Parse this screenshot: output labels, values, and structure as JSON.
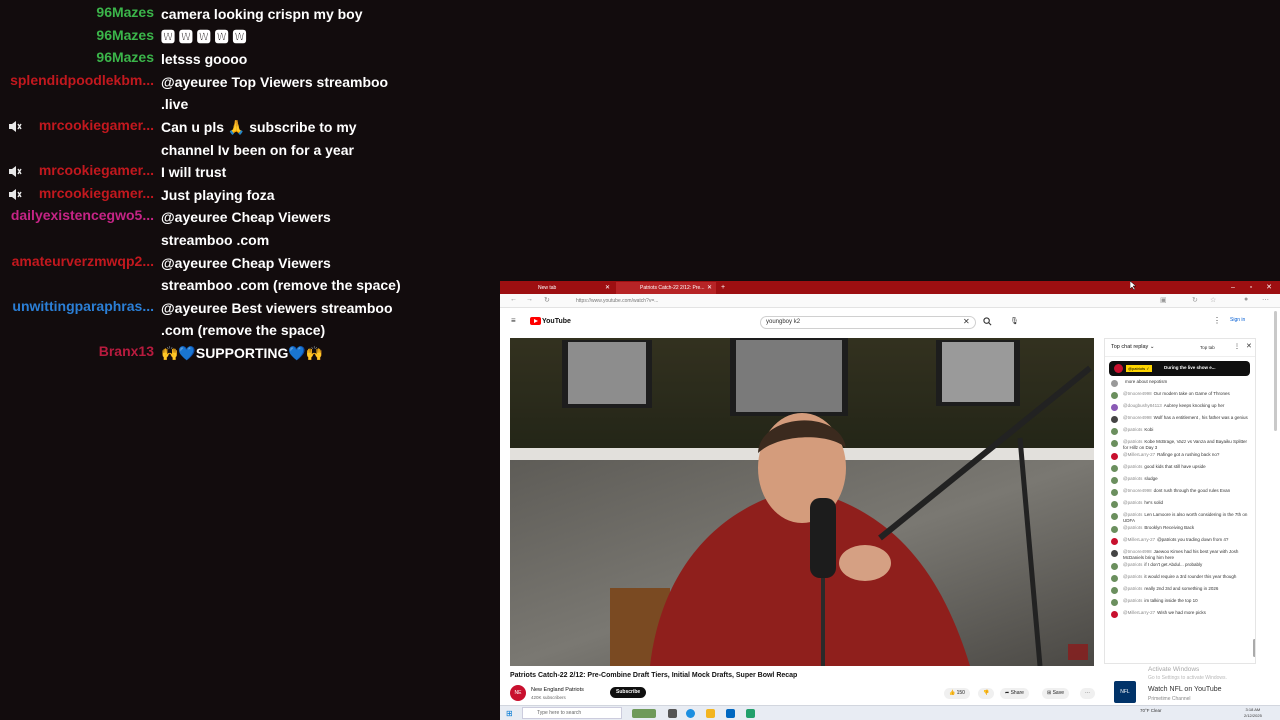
{
  "colors": {
    "background": "#120c0d",
    "name_green": "#3bb54a",
    "name_red": "#c2181e",
    "name_magenta": "#c52486",
    "name_blue": "#2b7fd6",
    "name_dark_red": "#b81b3e",
    "browser_tabstrip": "#9d0f11",
    "youtube_red": "#ff0000"
  },
  "chat": [
    {
      "name": "96Mazes",
      "color": "#3bb54a",
      "message": "camera looking crispn my boy",
      "muted": false
    },
    {
      "name": "96Mazes",
      "color": "#3bb54a",
      "message": "🆆 🆆 🆆 🆆 🆆",
      "muted": false
    },
    {
      "name": "96Mazes",
      "color": "#3bb54a",
      "message": "letsss goooo",
      "muted": false
    },
    {
      "name": "splendidpoodlekbm...",
      "color": "#c2181e",
      "message": "@ayeuree Top Viewers streamboo .live",
      "muted": false
    },
    {
      "name": "mrcookiegamer...",
      "color": "#c2181e",
      "message": "Can u pls 🙏 subscribe to my channel Iv been on for a year",
      "muted": true
    },
    {
      "name": "mrcookiegamer...",
      "color": "#c2181e",
      "message": "I will trust",
      "muted": true
    },
    {
      "name": "mrcookiegamer...",
      "color": "#c2181e",
      "message": "Just playing foza",
      "muted": true
    },
    {
      "name": "dailyexistencegwo5...",
      "color": "#c52486",
      "message": "@ayeuree Cheap Viewers streamboo .com",
      "muted": false
    },
    {
      "name": "amateurverzmwqp2...",
      "color": "#c2181e",
      "message": "@ayeuree Cheap Viewers streamboo .com (remove the space)",
      "muted": false
    },
    {
      "name": "unwittingparaphras...",
      "color": "#2b7fd6",
      "message": "@ayeuree Best viewers streamboo .com (remove the space)",
      "muted": false
    },
    {
      "name": "Branx13",
      "color": "#b81b3e",
      "message": "🙌💙SUPPORTING💙🙌",
      "muted": false
    }
  ],
  "browser": {
    "tabs": [
      {
        "label": "New tab",
        "active": false
      },
      {
        "label": "Patriots Catch-22 2/12: Pre...",
        "active": true
      }
    ],
    "new_tab_icon": "plus-icon",
    "url": "https://www.youtube.com/watch?v=...",
    "window_controls": [
      "–",
      "▫",
      "✕"
    ]
  },
  "youtube": {
    "logo_text": "YouTube",
    "search_value": "youngboy k2",
    "sign_in": "Sign in",
    "video_title": "Patriots Catch-22 2/12: Pre-Combine Draft Tiers, Initial Mock Drafts, Super Bowl Recap",
    "channel_name": "New England Patriots",
    "channel_avatar_text": "NE",
    "channel_subs": "420K subscribers",
    "subscribe_label": "Subscribe",
    "like_count": "150",
    "share_label": "Share",
    "save_label": "Save"
  },
  "live_chat": {
    "mode": "Top chat replay ⌄",
    "tab_label": "Top tab",
    "pinned_badge": "@patriots ✓",
    "pinned_text": "During the live show e...",
    "messages": [
      {
        "author": "",
        "text": "more about nepotism",
        "color": "#999999"
      },
      {
        "author": "@tmoore4998",
        "text": "Our modern take on Game of Thrones",
        "color": "#6b8f5e"
      },
      {
        "author": "@dougbushy84113",
        "text": "Aubrey keeps knocking up her",
        "color": "#8a5ab5"
      },
      {
        "author": "@tmoore4998",
        "text": "Wolf has a entitlement , his father was a genius",
        "color": "#444444"
      },
      {
        "author": "@patriots",
        "text": "Kobi",
        "color": "#6b8f5e"
      },
      {
        "author": "@patriots",
        "text": "Kobe McBrage, Vazz vs Vanza and Bayaiku Splitter for Hillz on Day 3",
        "color": "#6b8f5e"
      },
      {
        "author": "@MillerLarry-27",
        "text": "Rafinge got a rushing back no?",
        "color": "#c8102e"
      },
      {
        "author": "@patriots",
        "text": "good kids that still have upside",
        "color": "#6b8f5e"
      },
      {
        "author": "@patriots",
        "text": "sludge",
        "color": "#6b8f5e"
      },
      {
        "author": "@tmoore4998",
        "text": "dont rush through the good rules Evan",
        "color": "#6b8f5e"
      },
      {
        "author": "@patriots",
        "text": "he's solid",
        "color": "#6b8f5e"
      },
      {
        "author": "@patriots",
        "text": "Len Lamoore is also worth considering in the 7th on UDFA",
        "color": "#6b8f5e"
      },
      {
        "author": "@patriots",
        "text": "Brooklyn Receiving Back",
        "color": "#6b8f5e"
      },
      {
        "author": "@MillerLarry-27",
        "text": "@patriots you trading down from 4?",
        "color": "#c8102e"
      },
      {
        "author": "@tmoore4998",
        "text": "Jaewoo Kimes had his best year with Josh McDaniels bring him here",
        "color": "#444444"
      },
      {
        "author": "@patriots",
        "text": "if I don't get Abdul... probably",
        "color": "#6b8f5e"
      },
      {
        "author": "@patriots",
        "text": "it would require a 3rd rounder this year though",
        "color": "#6b8f5e"
      },
      {
        "author": "@patriots",
        "text": "really 2nd 3rd and something in 2026",
        "color": "#6b8f5e"
      },
      {
        "author": "@patriots",
        "text": "im talking inside the top 10",
        "color": "#6b8f5e"
      },
      {
        "author": "@MillerLarry-27",
        "text": "Wish we had more picks",
        "color": "#c8102e"
      }
    ]
  },
  "sidebar_promo": {
    "logo_text": "NFL",
    "title": "Watch NFL on YouTube",
    "subtitle": "Primetime Channel"
  },
  "windows_notice": {
    "title": "Activate Windows",
    "subtitle": "Go to Settings to activate Windows."
  },
  "taskbar": {
    "search_placeholder": "Type here to search",
    "tray": "70°F Clear",
    "time": "3:18 AM",
    "date": "2/12/2025"
  }
}
